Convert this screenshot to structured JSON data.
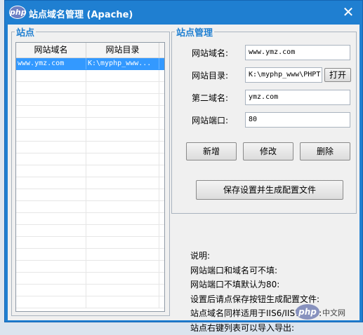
{
  "window": {
    "title": "站点域名管理 (Apache)",
    "logo_text": "php",
    "close_glyph": "✕"
  },
  "sites_group": {
    "title": "站点",
    "columns": [
      "网站域名",
      "网站目录"
    ],
    "rows": [
      {
        "domain": "www.ymz.com",
        "dir": "K:\\myphp_www...",
        "selected": true
      }
    ]
  },
  "manage_group": {
    "title": "站点管理",
    "domain_label": "网站域名:",
    "domain_value": "www.ymz.com",
    "dir_label": "网站目录:",
    "dir_value": "K:\\myphp_www\\PHPT",
    "open_button": "打开",
    "alias_label": "第二域名:",
    "alias_value": "ymz.com",
    "port_label": "网站端口:",
    "port_value": "80",
    "add_button": "新增",
    "edit_button": "修改",
    "delete_button": "删除",
    "save_button": "保存设置并生成配置文件"
  },
  "notes": [
    "说明:",
    "网站端口和域名可不填:",
    "网站端口不填默认为80:",
    "设置后请点保存按钮生成配置文件:",
    "站点域名同样适用于IIS6/IIS7/IIS8:",
    "站点右键列表可以导入导出:"
  ],
  "watermark": {
    "logo_text": "php",
    "text": "中文网"
  }
}
